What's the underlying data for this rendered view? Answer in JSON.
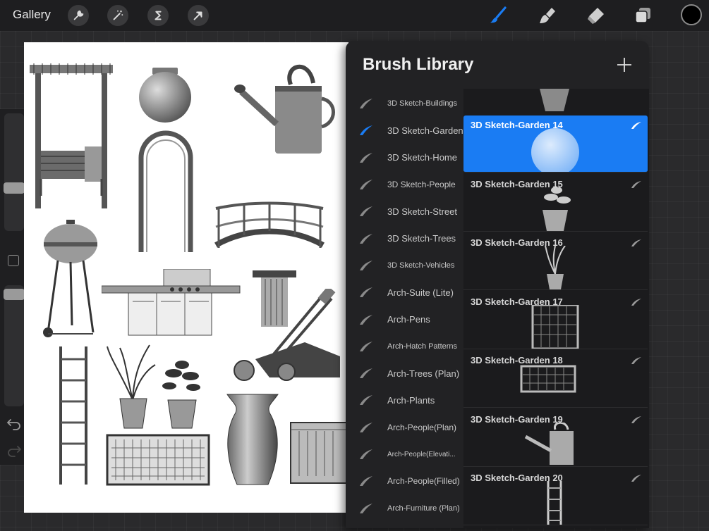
{
  "topbar": {
    "gallery_label": "Gallery",
    "left_tools": [
      "wrench-icon",
      "magic-wand-icon",
      "selection-s-icon",
      "transform-arrow-icon"
    ],
    "right_tools": [
      "brush-icon",
      "smudge-icon",
      "eraser-icon",
      "layers-icon"
    ],
    "active_tool": "brush-icon",
    "current_color": "#000000"
  },
  "sidebar": {
    "brush_size_level": 0.38,
    "opacity_level": 0.04
  },
  "panel": {
    "title": "Brush Library",
    "accent_color": "#1a7cf3",
    "brush_sets": [
      {
        "label": "3D Sketch-Buildings",
        "size": 11
      },
      {
        "label": "3D Sketch-Garden",
        "size": 13,
        "selected": true
      },
      {
        "label": "3D Sketch-Home",
        "size": 13
      },
      {
        "label": "3D Sketch-People",
        "size": 12
      },
      {
        "label": "3D Sketch-Street",
        "size": 13
      },
      {
        "label": "3D Sketch-Trees",
        "size": 13
      },
      {
        "label": "3D Sketch-Vehicles",
        "size": 11
      },
      {
        "label": "Arch-Suite (Lite)",
        "size": 13
      },
      {
        "label": "Arch-Pens",
        "size": 13
      },
      {
        "label": "Arch-Hatch Patterns",
        "size": 11
      },
      {
        "label": "Arch-Trees (Plan)",
        "size": 13
      },
      {
        "label": "Arch-Plants",
        "size": 13
      },
      {
        "label": "Arch-People(Plan)",
        "size": 12
      },
      {
        "label": "Arch-People(Elevati...",
        "size": 10
      },
      {
        "label": "Arch-People(Filled)",
        "size": 12
      },
      {
        "label": "Arch-Furniture (Plan)",
        "size": 11
      }
    ],
    "brushes": [
      {
        "name": "3D Sketch-Garden 14",
        "selected": true,
        "thumb": "globe"
      },
      {
        "name": "3D Sketch-Garden 15",
        "thumb": "potted-plant"
      },
      {
        "name": "3D Sketch-Garden 16",
        "thumb": "grass-pot"
      },
      {
        "name": "3D Sketch-Garden 17",
        "thumb": "lattice-panel"
      },
      {
        "name": "3D Sketch-Garden 18",
        "thumb": "lattice-planter"
      },
      {
        "name": "3D Sketch-Garden 19",
        "thumb": "watering-can"
      },
      {
        "name": "3D Sketch-Garden 20",
        "thumb": "ladder"
      }
    ]
  }
}
